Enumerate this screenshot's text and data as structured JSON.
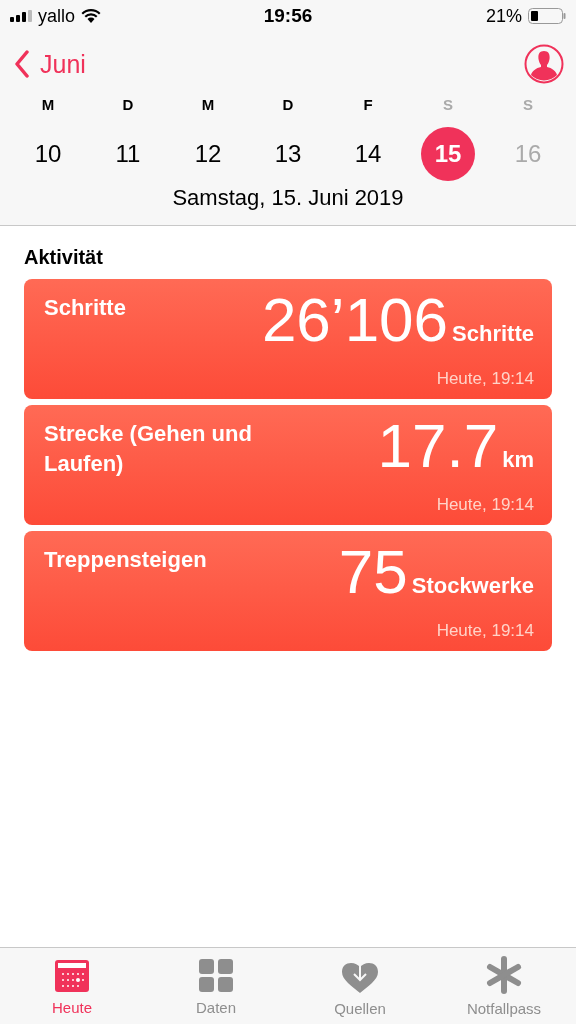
{
  "status_bar": {
    "carrier": "yallo",
    "time": "19:56",
    "battery": "21%"
  },
  "nav": {
    "back": "Juni"
  },
  "week": [
    {
      "weekday": "M",
      "date": "10",
      "selected": false,
      "dimmed": false
    },
    {
      "weekday": "D",
      "date": "11",
      "selected": false,
      "dimmed": false
    },
    {
      "weekday": "M",
      "date": "12",
      "selected": false,
      "dimmed": false
    },
    {
      "weekday": "D",
      "date": "13",
      "selected": false,
      "dimmed": false
    },
    {
      "weekday": "F",
      "date": "14",
      "selected": false,
      "dimmed": false
    },
    {
      "weekday": "S",
      "date": "15",
      "selected": true,
      "dimmed": true
    },
    {
      "weekday": "S",
      "date": "16",
      "selected": false,
      "dimmed": true
    }
  ],
  "selected_date": "Samstag, 15. Juni 2019",
  "section_title": "Aktivität",
  "cards": [
    {
      "title": "Schritte",
      "value": "26’106",
      "unit": "Schritte",
      "time": "Heute, 19:14"
    },
    {
      "title": "Strecke (Gehen und Laufen)",
      "value": "17.7",
      "unit": "km",
      "time": "Heute, 19:14"
    },
    {
      "title": "Treppensteigen",
      "value": "75",
      "unit": "Stockwerke",
      "time": "Heute, 19:14"
    }
  ],
  "tabs": [
    {
      "label": "Heute",
      "selected": true
    },
    {
      "label": "Daten",
      "selected": false
    },
    {
      "label": "Quellen",
      "selected": false
    },
    {
      "label": "Notfallpass",
      "selected": false
    }
  ]
}
